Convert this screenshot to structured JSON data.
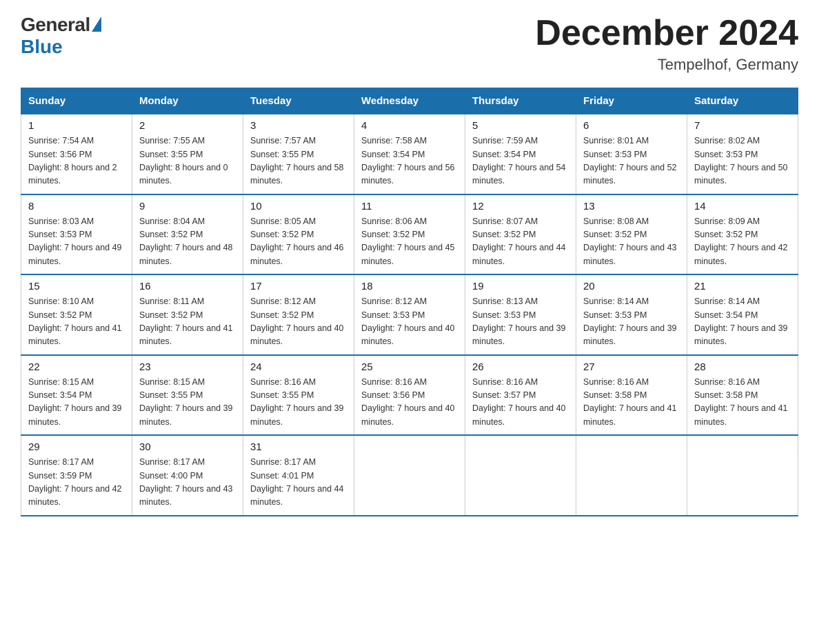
{
  "header": {
    "logo_general": "General",
    "logo_blue": "Blue",
    "month_title": "December 2024",
    "location": "Tempelhof, Germany"
  },
  "weekdays": [
    "Sunday",
    "Monday",
    "Tuesday",
    "Wednesday",
    "Thursday",
    "Friday",
    "Saturday"
  ],
  "weeks": [
    [
      {
        "day": "1",
        "sunrise": "7:54 AM",
        "sunset": "3:56 PM",
        "daylight": "8 hours and 2 minutes."
      },
      {
        "day": "2",
        "sunrise": "7:55 AM",
        "sunset": "3:55 PM",
        "daylight": "8 hours and 0 minutes."
      },
      {
        "day": "3",
        "sunrise": "7:57 AM",
        "sunset": "3:55 PM",
        "daylight": "7 hours and 58 minutes."
      },
      {
        "day": "4",
        "sunrise": "7:58 AM",
        "sunset": "3:54 PM",
        "daylight": "7 hours and 56 minutes."
      },
      {
        "day": "5",
        "sunrise": "7:59 AM",
        "sunset": "3:54 PM",
        "daylight": "7 hours and 54 minutes."
      },
      {
        "day": "6",
        "sunrise": "8:01 AM",
        "sunset": "3:53 PM",
        "daylight": "7 hours and 52 minutes."
      },
      {
        "day": "7",
        "sunrise": "8:02 AM",
        "sunset": "3:53 PM",
        "daylight": "7 hours and 50 minutes."
      }
    ],
    [
      {
        "day": "8",
        "sunrise": "8:03 AM",
        "sunset": "3:53 PM",
        "daylight": "7 hours and 49 minutes."
      },
      {
        "day": "9",
        "sunrise": "8:04 AM",
        "sunset": "3:52 PM",
        "daylight": "7 hours and 48 minutes."
      },
      {
        "day": "10",
        "sunrise": "8:05 AM",
        "sunset": "3:52 PM",
        "daylight": "7 hours and 46 minutes."
      },
      {
        "day": "11",
        "sunrise": "8:06 AM",
        "sunset": "3:52 PM",
        "daylight": "7 hours and 45 minutes."
      },
      {
        "day": "12",
        "sunrise": "8:07 AM",
        "sunset": "3:52 PM",
        "daylight": "7 hours and 44 minutes."
      },
      {
        "day": "13",
        "sunrise": "8:08 AM",
        "sunset": "3:52 PM",
        "daylight": "7 hours and 43 minutes."
      },
      {
        "day": "14",
        "sunrise": "8:09 AM",
        "sunset": "3:52 PM",
        "daylight": "7 hours and 42 minutes."
      }
    ],
    [
      {
        "day": "15",
        "sunrise": "8:10 AM",
        "sunset": "3:52 PM",
        "daylight": "7 hours and 41 minutes."
      },
      {
        "day": "16",
        "sunrise": "8:11 AM",
        "sunset": "3:52 PM",
        "daylight": "7 hours and 41 minutes."
      },
      {
        "day": "17",
        "sunrise": "8:12 AM",
        "sunset": "3:52 PM",
        "daylight": "7 hours and 40 minutes."
      },
      {
        "day": "18",
        "sunrise": "8:12 AM",
        "sunset": "3:53 PM",
        "daylight": "7 hours and 40 minutes."
      },
      {
        "day": "19",
        "sunrise": "8:13 AM",
        "sunset": "3:53 PM",
        "daylight": "7 hours and 39 minutes."
      },
      {
        "day": "20",
        "sunrise": "8:14 AM",
        "sunset": "3:53 PM",
        "daylight": "7 hours and 39 minutes."
      },
      {
        "day": "21",
        "sunrise": "8:14 AM",
        "sunset": "3:54 PM",
        "daylight": "7 hours and 39 minutes."
      }
    ],
    [
      {
        "day": "22",
        "sunrise": "8:15 AM",
        "sunset": "3:54 PM",
        "daylight": "7 hours and 39 minutes."
      },
      {
        "day": "23",
        "sunrise": "8:15 AM",
        "sunset": "3:55 PM",
        "daylight": "7 hours and 39 minutes."
      },
      {
        "day": "24",
        "sunrise": "8:16 AM",
        "sunset": "3:55 PM",
        "daylight": "7 hours and 39 minutes."
      },
      {
        "day": "25",
        "sunrise": "8:16 AM",
        "sunset": "3:56 PM",
        "daylight": "7 hours and 40 minutes."
      },
      {
        "day": "26",
        "sunrise": "8:16 AM",
        "sunset": "3:57 PM",
        "daylight": "7 hours and 40 minutes."
      },
      {
        "day": "27",
        "sunrise": "8:16 AM",
        "sunset": "3:58 PM",
        "daylight": "7 hours and 41 minutes."
      },
      {
        "day": "28",
        "sunrise": "8:16 AM",
        "sunset": "3:58 PM",
        "daylight": "7 hours and 41 minutes."
      }
    ],
    [
      {
        "day": "29",
        "sunrise": "8:17 AM",
        "sunset": "3:59 PM",
        "daylight": "7 hours and 42 minutes."
      },
      {
        "day": "30",
        "sunrise": "8:17 AM",
        "sunset": "4:00 PM",
        "daylight": "7 hours and 43 minutes."
      },
      {
        "day": "31",
        "sunrise": "8:17 AM",
        "sunset": "4:01 PM",
        "daylight": "7 hours and 44 minutes."
      },
      null,
      null,
      null,
      null
    ]
  ]
}
